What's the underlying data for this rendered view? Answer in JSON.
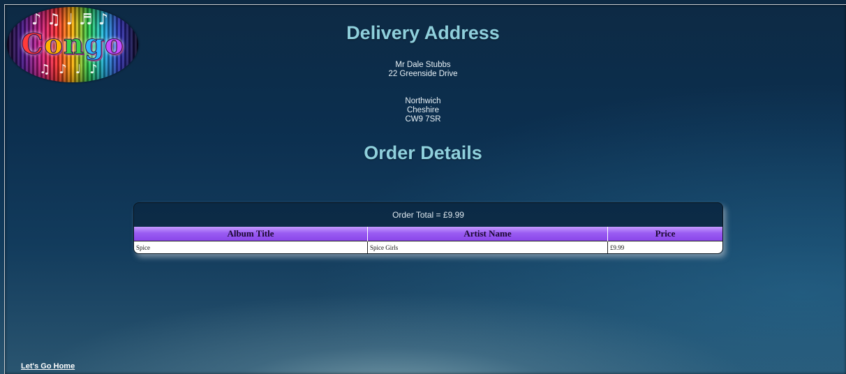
{
  "logo": {
    "text_letters": [
      "C",
      "o",
      "n",
      "g",
      "o"
    ],
    "notes_top": "♪♫♩♬♪",
    "notes_bottom": "♫♪♩♪"
  },
  "delivery": {
    "title": "Delivery Address",
    "name": "Mr Dale Stubbs",
    "street": "22 Greenside Drive",
    "town": "Northwich",
    "county": "Cheshire",
    "postcode": "CW9 7SR"
  },
  "order": {
    "title": "Order Details",
    "total": "Order Total = £9.99",
    "columns": [
      "Album Title",
      "Artist Name",
      "Price"
    ],
    "rows": [
      {
        "album": "Spice",
        "artist": "Spice Girls",
        "price": "£9.99"
      }
    ]
  },
  "footer": {
    "home_link": "Let's Go Home"
  },
  "colors": {
    "heading": "#8fd0dc",
    "table_header": "#9a5cf2",
    "background": "#0c2f4f"
  }
}
